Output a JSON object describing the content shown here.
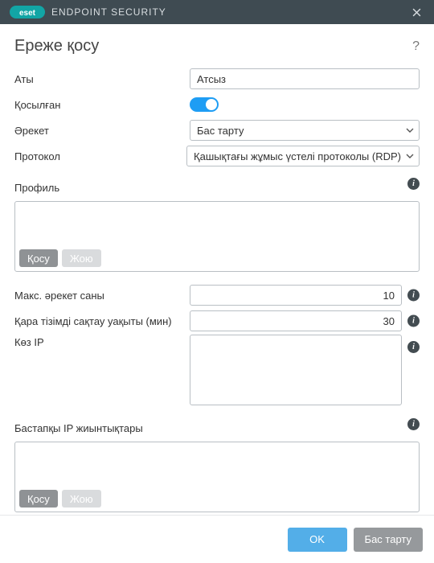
{
  "titlebar": {
    "brand_suffix": "ENDPOINT SECURITY"
  },
  "header": {
    "title": "Ереже қосу",
    "help": "?"
  },
  "form": {
    "name": {
      "label": "Аты",
      "value": "Атсыз"
    },
    "enabled": {
      "label": "Қосылған",
      "value": true
    },
    "action": {
      "label": "Әрекет",
      "value": "Бас тарту"
    },
    "protocol": {
      "label": "Протокол",
      "value": "Қашықтағы жұмыс үстелі протоколы (RDP)"
    },
    "profile": {
      "label": "Профиль",
      "add": "Қосу",
      "del": "Жою"
    },
    "max_attempts": {
      "label": "Макс. әрекет саны",
      "value": "10"
    },
    "blacklist_retention": {
      "label": "Қара тізімді сақтау уақыты (мин)",
      "value": "30"
    },
    "source_ip": {
      "label": "Көз IP",
      "value": ""
    },
    "source_ip_sets": {
      "label": "Бастапқы IP жиынтықтары",
      "add": "Қосу",
      "del": "Жою"
    }
  },
  "footer": {
    "ok": "OK",
    "cancel": "Бас тарту"
  },
  "info_glyph": "i"
}
